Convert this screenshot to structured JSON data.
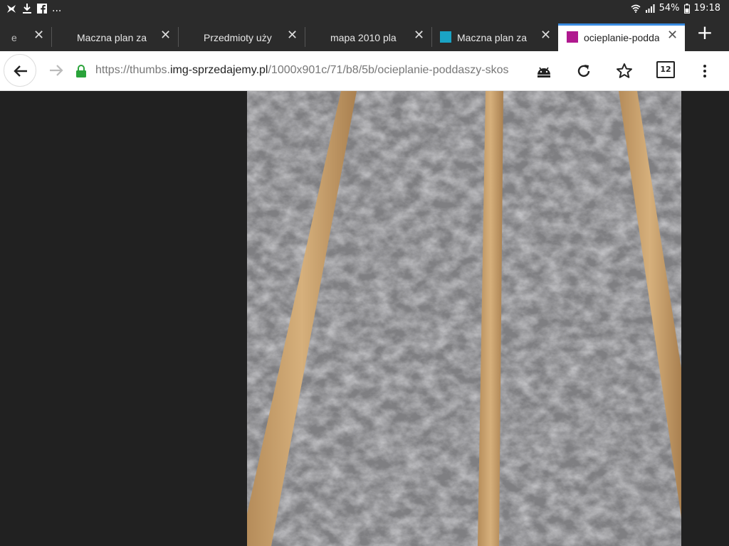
{
  "status_bar": {
    "left_icons": [
      "app-icon",
      "download-icon",
      "facebook-icon"
    ],
    "more": "...",
    "battery": "54%",
    "time": "19:18"
  },
  "tabs": [
    {
      "title": "e",
      "active": false,
      "favicon": null
    },
    {
      "title": "Maczna plan za",
      "active": false,
      "favicon": null
    },
    {
      "title": "Przedmioty uży",
      "active": false,
      "favicon": null
    },
    {
      "title": "mapa 2010 pla",
      "active": false,
      "favicon": null
    },
    {
      "title": "Maczna plan za",
      "active": false,
      "favicon": "#1aa3c4"
    },
    {
      "title": "ocieplanie-podda",
      "active": true,
      "favicon": "#b0198f"
    }
  ],
  "toolbar": {
    "url_scheme": "https://thumbs.",
    "url_host": "img-sprzedajemy.pl",
    "url_path": "/1000x901c/71/b8/5b/ocieplanie-poddaszy-skos",
    "tab_count": "12"
  },
  "colors": {
    "active_tab_accent": "#3a8ce0",
    "lock_green": "#2aa33a",
    "page_background": "#212121"
  },
  "content": {
    "image_subject": "insulation-between-wooden-rafters"
  }
}
